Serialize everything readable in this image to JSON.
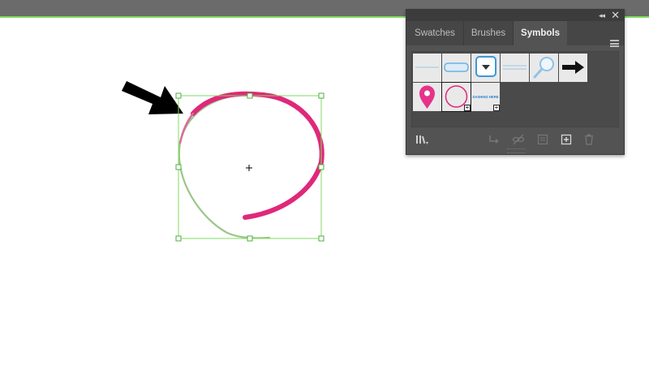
{
  "canvas": {
    "background": "#ffffff",
    "top_bar_color": "#6b6b6b",
    "artboard_edge_color": "#7fdc5f",
    "pointer_arrow_icon": "arrow-icon",
    "selected_object": {
      "name": "hand-drawn circle",
      "stroke_color": "#e0287a",
      "bounding_box_color": "#7fdc5f"
    }
  },
  "panel": {
    "collapse_icon": "double-chevron-icon",
    "close_icon": "close-icon",
    "tabs": [
      {
        "label": "Swatches",
        "active": false
      },
      {
        "label": "Brushes",
        "active": false
      },
      {
        "label": "Symbols",
        "active": true
      }
    ],
    "menu_icon": "hamburger-menu-icon",
    "symbols": [
      {
        "name": "thin-line-symbol"
      },
      {
        "name": "rounded-bar-symbol"
      },
      {
        "name": "dropdown-button-symbol"
      },
      {
        "name": "double-line-symbol"
      },
      {
        "name": "magnifier-symbol"
      },
      {
        "name": "arrow-symbol"
      },
      {
        "name": "map-pin-symbol"
      },
      {
        "name": "circle-symbol",
        "selected": true
      },
      {
        "name": "dashed-text-symbol",
        "text": "DASHING HERE"
      }
    ],
    "bottom_icons": [
      "symbol-libraries-icon",
      "place-symbol-icon",
      "break-link-icon",
      "symbol-options-icon",
      "new-symbol-icon",
      "delete-symbol-icon"
    ]
  }
}
